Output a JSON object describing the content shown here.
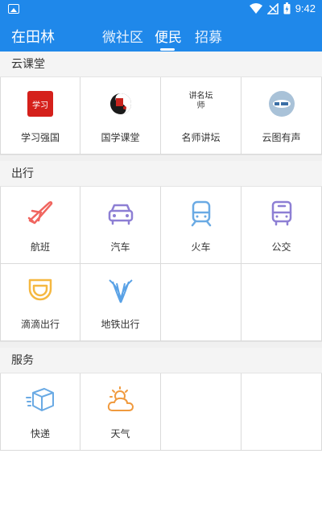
{
  "status_bar": {
    "time": "9:42"
  },
  "header": {
    "brand": "在田林",
    "tabs": [
      {
        "label": "微社区",
        "active": false
      },
      {
        "label": "便民",
        "active": true
      },
      {
        "label": "招募",
        "active": false
      }
    ]
  },
  "sections": [
    {
      "title": "云课堂",
      "items": [
        {
          "label": "学习强国",
          "icon": "xuexi-qiangguo-logo",
          "logo_text": "学习"
        },
        {
          "label": "国学课堂",
          "icon": "guoxue-ketang-logo"
        },
        {
          "label": "名师讲坛",
          "icon": "mingshi-jiangtan-logo",
          "logo_text": "讲名坛师"
        },
        {
          "label": "云图有声",
          "icon": "yuntu-yousheng-logo"
        }
      ]
    },
    {
      "title": "出行",
      "items": [
        {
          "label": "航班",
          "icon": "airplane-icon"
        },
        {
          "label": "汽车",
          "icon": "car-icon"
        },
        {
          "label": "火车",
          "icon": "train-icon"
        },
        {
          "label": "公交",
          "icon": "bus-icon"
        },
        {
          "label": "滴滴出行",
          "icon": "didi-icon"
        },
        {
          "label": "地铁出行",
          "icon": "metro-icon"
        }
      ]
    },
    {
      "title": "服务",
      "items": [
        {
          "label": "快递",
          "icon": "package-icon"
        },
        {
          "label": "天气",
          "icon": "weather-icon"
        }
      ]
    }
  ],
  "colors": {
    "primary": "#1f88ea",
    "travel_red": "#f0655f",
    "travel_purple": "#8d7fd4",
    "travel_blue": "#6aaae4",
    "didi_orange": "#f5b841",
    "metro_blue": "#5aa2e6",
    "weather_orange": "#f09a3e"
  }
}
